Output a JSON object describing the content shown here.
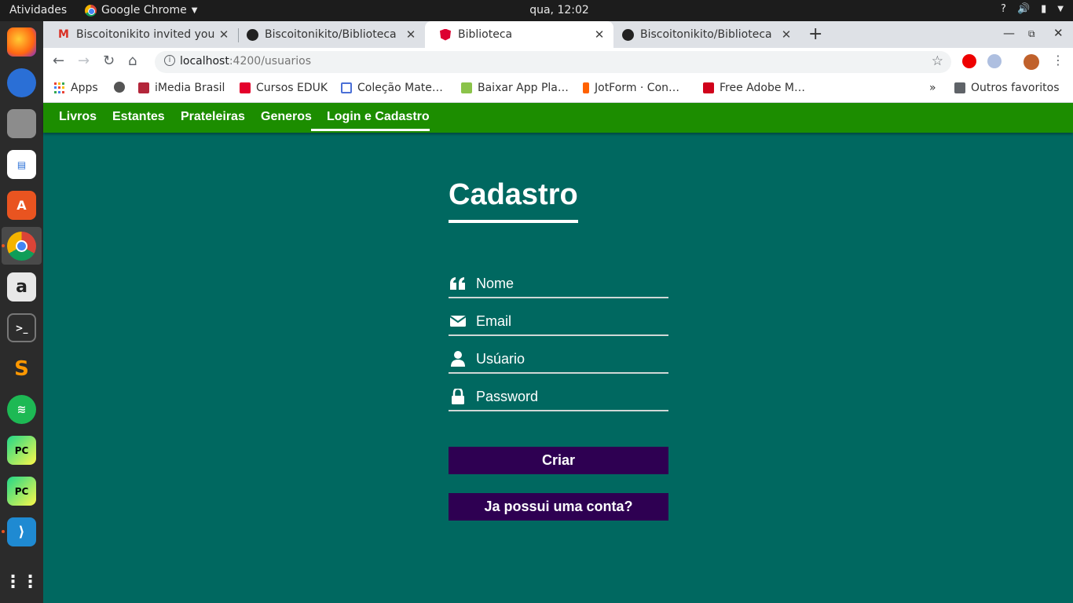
{
  "system": {
    "activities": "Atividades",
    "app_name": "Google Chrome",
    "clock": "qua, 12:02",
    "tray_help": "?"
  },
  "browser": {
    "tabs": [
      {
        "title": "Biscoitonikito invited you",
        "icon": "gmail-icon"
      },
      {
        "title": "Biscoitonikito/Biblioteca",
        "icon": "github-icon"
      },
      {
        "title": "Biblioteca",
        "icon": "angular-icon"
      },
      {
        "title": "Biscoitonikito/Biblioteca",
        "icon": "github-icon"
      }
    ],
    "address": {
      "host": "localhost",
      "path": ":4200/usuarios"
    },
    "bookmarks": [
      {
        "label": "Apps",
        "icon": "apps-grid-icon"
      },
      {
        "label": "",
        "icon": "globe-icon"
      },
      {
        "label": "iMedia Brasil",
        "icon": "imedia-icon"
      },
      {
        "label": "Cursos EDUK",
        "icon": "eduk-icon"
      },
      {
        "label": "Coleção Mate…",
        "icon": "calendar-icon"
      },
      {
        "label": "Baixar App Pla…",
        "icon": "android-icon"
      },
      {
        "label": "JotForm · Con…",
        "icon": "jotform-icon"
      },
      {
        "label": "Free Adobe M…",
        "icon": "mail-icon"
      }
    ],
    "bookmarks_more": "»",
    "other_bookmarks": "Outros favoritos"
  },
  "navbar": {
    "items": [
      "Livros",
      "Estantes",
      "Prateleiras",
      "Generos",
      "Login e Cadastro"
    ],
    "active_index": 4
  },
  "form": {
    "title": "Cadastro",
    "fields": [
      {
        "placeholder": "Nome",
        "icon": "quote-icon",
        "value": ""
      },
      {
        "placeholder": "Email",
        "icon": "envelope-icon",
        "value": ""
      },
      {
        "placeholder": "Usúario",
        "icon": "user-icon",
        "value": ""
      },
      {
        "placeholder": "Password",
        "icon": "lock-icon",
        "value": ""
      }
    ],
    "submit_label": "Criar",
    "login_label": "Ja possui uma conta?"
  },
  "colors": {
    "page_bg": "#006860",
    "navbar_bg": "#1c8d00",
    "button_bg": "#2e0052"
  }
}
